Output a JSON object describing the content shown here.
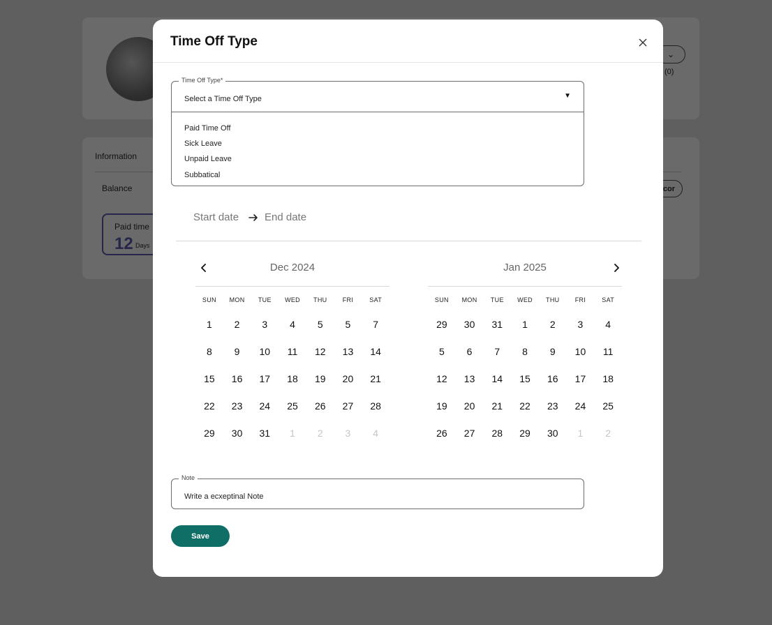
{
  "background": {
    "dropdown_caret": "⌄",
    "count": "(0)",
    "tab_information": "Information",
    "balance_label": "Balance",
    "pill_label": "cor",
    "paid_time_label": "Paid time",
    "paid_time_value": "12",
    "paid_time_unit": "Days"
  },
  "modal": {
    "title": "Time Off Type",
    "close_icon": "close-icon",
    "type_field": {
      "label": "Time Off Type*",
      "placeholder": "Select a Time Off Type",
      "options": [
        "Paid Time Off",
        "Sick Leave",
        "Unpaid Leave",
        "Subbatical"
      ]
    },
    "date_range": {
      "start_placeholder": "Start date",
      "end_placeholder": "End date"
    },
    "calendars": [
      {
        "title": "Dec 2024",
        "weekdays": [
          "SUN",
          "MON",
          "TUE",
          "WED",
          "THU",
          "FRI",
          "SAT"
        ],
        "weeks": [
          [
            {
              "d": "1"
            },
            {
              "d": "2"
            },
            {
              "d": "3"
            },
            {
              "d": "4"
            },
            {
              "d": "5"
            },
            {
              "d": "5"
            },
            {
              "d": "7"
            }
          ],
          [
            {
              "d": "8"
            },
            {
              "d": "9"
            },
            {
              "d": "10"
            },
            {
              "d": "11"
            },
            {
              "d": "12"
            },
            {
              "d": "13"
            },
            {
              "d": "14"
            }
          ],
          [
            {
              "d": "15"
            },
            {
              "d": "16"
            },
            {
              "d": "17"
            },
            {
              "d": "18"
            },
            {
              "d": "19"
            },
            {
              "d": "20"
            },
            {
              "d": "21"
            }
          ],
          [
            {
              "d": "22"
            },
            {
              "d": "23"
            },
            {
              "d": "24"
            },
            {
              "d": "25"
            },
            {
              "d": "26"
            },
            {
              "d": "27"
            },
            {
              "d": "28"
            }
          ],
          [
            {
              "d": "29"
            },
            {
              "d": "30"
            },
            {
              "d": "31"
            },
            {
              "d": "1",
              "muted": true
            },
            {
              "d": "2",
              "muted": true
            },
            {
              "d": "3",
              "muted": true
            },
            {
              "d": "4",
              "muted": true
            }
          ]
        ]
      },
      {
        "title": "Jan 2025",
        "weekdays": [
          "SUN",
          "MON",
          "TUE",
          "WED",
          "THU",
          "FRI",
          "SAT"
        ],
        "weeks": [
          [
            {
              "d": "29"
            },
            {
              "d": "30"
            },
            {
              "d": "31"
            },
            {
              "d": "1"
            },
            {
              "d": "2"
            },
            {
              "d": "3"
            },
            {
              "d": "4"
            }
          ],
          [
            {
              "d": "5"
            },
            {
              "d": "6"
            },
            {
              "d": "7"
            },
            {
              "d": "8"
            },
            {
              "d": "9"
            },
            {
              "d": "10"
            },
            {
              "d": "11"
            }
          ],
          [
            {
              "d": "12"
            },
            {
              "d": "13"
            },
            {
              "d": "14"
            },
            {
              "d": "15"
            },
            {
              "d": "16"
            },
            {
              "d": "17"
            },
            {
              "d": "18"
            }
          ],
          [
            {
              "d": "19"
            },
            {
              "d": "20"
            },
            {
              "d": "21"
            },
            {
              "d": "22"
            },
            {
              "d": "23"
            },
            {
              "d": "24"
            },
            {
              "d": "25"
            }
          ],
          [
            {
              "d": "26"
            },
            {
              "d": "27"
            },
            {
              "d": "28"
            },
            {
              "d": "29"
            },
            {
              "d": "30"
            },
            {
              "d": "1",
              "muted": true
            },
            {
              "d": "2",
              "muted": true
            }
          ]
        ]
      }
    ],
    "note_field": {
      "label": "Note",
      "placeholder": "Write a ecxeptinal Note"
    },
    "save_label": "Save",
    "colors": {
      "save_bg": "#0f6e66",
      "overlay": "#5f5f5f"
    }
  }
}
